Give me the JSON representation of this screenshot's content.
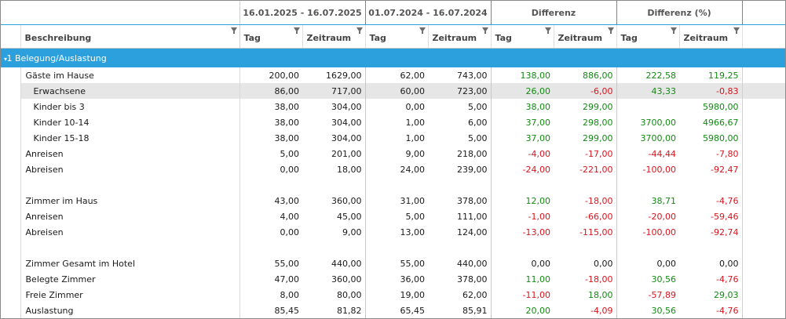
{
  "header": {
    "period1": "16.01.2025 - 16.07.2025",
    "period2": "01.07.2024 - 16.07.2024",
    "diff": "Differenz",
    "diff_pct": "Differenz (%)",
    "col_desc": "Beschreibung",
    "tag": "Tag",
    "zeitraum": "Zeitraum"
  },
  "group": {
    "title": "1 Belegung/Auslastung"
  },
  "rows": [
    {
      "label": "Gäste im Hause",
      "indent": false,
      "v": [
        "200,00",
        "1629,00",
        "62,00",
        "743,00",
        "138,00",
        "886,00",
        "222,58",
        "119,25"
      ]
    },
    {
      "label": "Erwachsene",
      "indent": true,
      "v": [
        "86,00",
        "717,00",
        "60,00",
        "723,00",
        "26,00",
        "-6,00",
        "43,33",
        "-0,83"
      ]
    },
    {
      "label": "Kinder bis 3",
      "indent": true,
      "v": [
        "38,00",
        "304,00",
        "0,00",
        "5,00",
        "38,00",
        "299,00",
        "",
        "5980,00"
      ]
    },
    {
      "label": "Kinder 10-14",
      "indent": true,
      "v": [
        "38,00",
        "304,00",
        "1,00",
        "6,00",
        "37,00",
        "298,00",
        "3700,00",
        "4966,67"
      ]
    },
    {
      "label": "Kinder 15-18",
      "indent": true,
      "v": [
        "38,00",
        "304,00",
        "1,00",
        "5,00",
        "37,00",
        "299,00",
        "3700,00",
        "5980,00"
      ]
    },
    {
      "label": "Anreisen",
      "indent": false,
      "v": [
        "5,00",
        "201,00",
        "9,00",
        "218,00",
        "-4,00",
        "-17,00",
        "-44,44",
        "-7,80"
      ]
    },
    {
      "label": "Abreisen",
      "indent": false,
      "v": [
        "0,00",
        "18,00",
        "24,00",
        "239,00",
        "-24,00",
        "-221,00",
        "-100,00",
        "-92,47"
      ]
    },
    {
      "label": "",
      "indent": false,
      "v": [
        "",
        "",
        "",
        "",
        "",
        "",
        "",
        ""
      ]
    },
    {
      "label": "Zimmer im Haus",
      "indent": false,
      "v": [
        "43,00",
        "360,00",
        "31,00",
        "378,00",
        "12,00",
        "-18,00",
        "38,71",
        "-4,76"
      ]
    },
    {
      "label": "Anreisen",
      "indent": false,
      "v": [
        "4,00",
        "45,00",
        "5,00",
        "111,00",
        "-1,00",
        "-66,00",
        "-20,00",
        "-59,46"
      ]
    },
    {
      "label": "Abreisen",
      "indent": false,
      "v": [
        "0,00",
        "9,00",
        "13,00",
        "124,00",
        "-13,00",
        "-115,00",
        "-100,00",
        "-92,74"
      ]
    },
    {
      "label": "",
      "indent": false,
      "v": [
        "",
        "",
        "",
        "",
        "",
        "",
        "",
        ""
      ]
    },
    {
      "label": "Zimmer Gesamt im Hotel",
      "indent": false,
      "v": [
        "55,00",
        "440,00",
        "55,00",
        "440,00",
        "0,00",
        "0,00",
        "0,00",
        "0,00"
      ]
    },
    {
      "label": "Belegte Zimmer",
      "indent": false,
      "v": [
        "47,00",
        "360,00",
        "36,00",
        "378,00",
        "11,00",
        "-18,00",
        "30,56",
        "-4,76"
      ]
    },
    {
      "label": "Freie Zimmer",
      "indent": false,
      "v": [
        "8,00",
        "80,00",
        "19,00",
        "62,00",
        "-11,00",
        "18,00",
        "-57,89",
        "29,03"
      ]
    },
    {
      "label": "Auslastung",
      "indent": false,
      "v": [
        "85,45",
        "81,82",
        "65,45",
        "85,91",
        "20,00",
        "-4,09",
        "30,56",
        "-4,76"
      ]
    }
  ],
  "colors": {
    "accent": "#2ba0dc",
    "positive": "#138a13",
    "negative": "#d9141e"
  },
  "selected_row": 1
}
